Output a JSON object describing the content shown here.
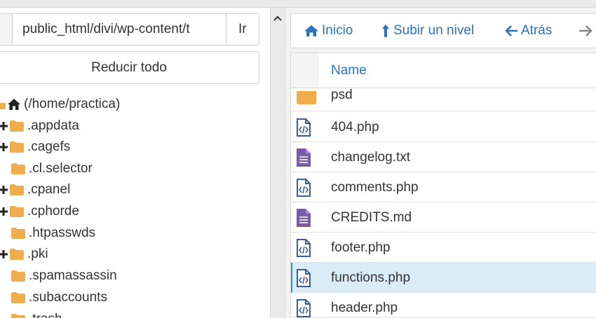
{
  "left": {
    "path_value": "public_html/divi/wp-content/t",
    "go_label": "Ir",
    "collapse_label": "Reducir todo",
    "tree": [
      {
        "label": "(/home/practica)",
        "expander": false,
        "icon": "home-icon"
      },
      {
        "label": ".appdata",
        "expander": true,
        "icon": "folder-icon"
      },
      {
        "label": ".cagefs",
        "expander": true,
        "icon": "folder-icon"
      },
      {
        "label": ".cl.selector",
        "expander": false,
        "icon": "folder-icon"
      },
      {
        "label": ".cpanel",
        "expander": true,
        "icon": "folder-icon"
      },
      {
        "label": ".cphorde",
        "expander": true,
        "icon": "folder-icon"
      },
      {
        "label": ".htpasswds",
        "expander": false,
        "icon": "folder-icon"
      },
      {
        "label": ".pki",
        "expander": true,
        "icon": "folder-icon"
      },
      {
        "label": ".spamassassin",
        "expander": false,
        "icon": "folder-icon"
      },
      {
        "label": ".subaccounts",
        "expander": false,
        "icon": "folder-icon"
      },
      {
        "label": ".trash",
        "expander": false,
        "icon": "folder-icon"
      }
    ]
  },
  "toolbar": {
    "home_label": "Inicio",
    "up_label": "Subir un nivel",
    "back_label": "Atrás"
  },
  "filelist": {
    "column_name": "Name",
    "rows": [
      {
        "name": "psd",
        "type": "folder"
      },
      {
        "name": "404.php",
        "type": "code"
      },
      {
        "name": "changelog.txt",
        "type": "text"
      },
      {
        "name": "comments.php",
        "type": "code"
      },
      {
        "name": "CREDITS.md",
        "type": "text"
      },
      {
        "name": "footer.php",
        "type": "code"
      },
      {
        "name": "functions.php",
        "type": "code",
        "selected": true
      },
      {
        "name": "header.php",
        "type": "code"
      }
    ]
  },
  "colors": {
    "accent": "#2a73b8",
    "folder": "#f0ad4e",
    "text_file": "#7b5aa6",
    "code_file": "#3b5f8a",
    "selected_row": "#d9ecf8"
  }
}
